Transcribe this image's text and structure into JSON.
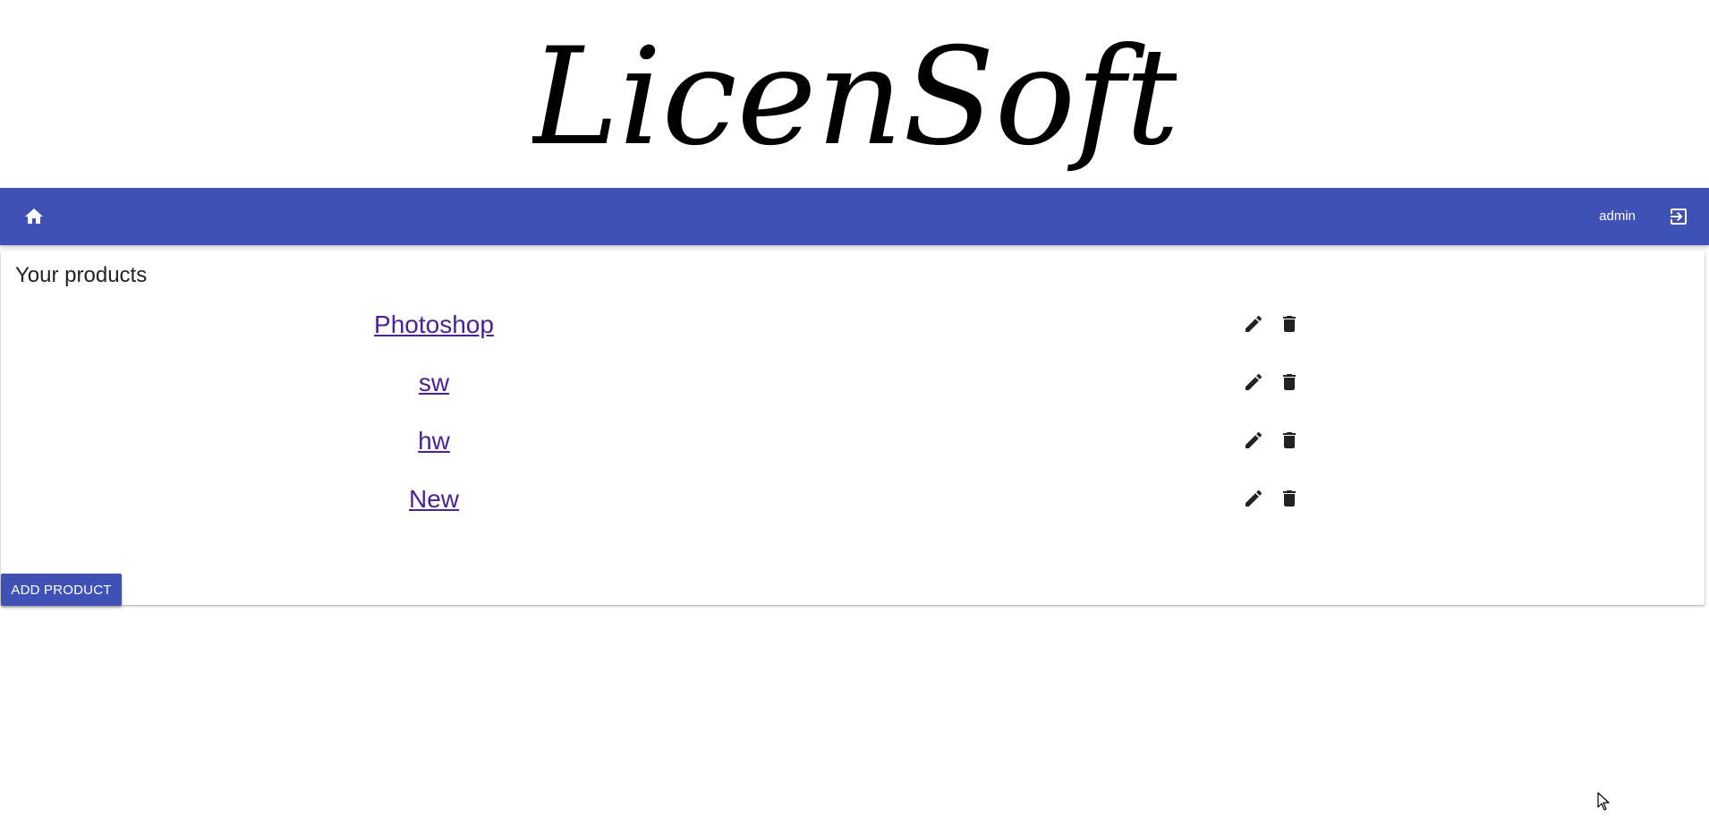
{
  "logo": {
    "text": "LicenSoft"
  },
  "appbar": {
    "home_icon": "home-icon",
    "username": "admin",
    "logout_icon": "logout-icon",
    "color": "#3f51b5"
  },
  "products_card": {
    "title": "Your products",
    "products": [
      {
        "name": "Photoshop"
      },
      {
        "name": "sw"
      },
      {
        "name": "hw"
      },
      {
        "name": "New"
      }
    ],
    "edit_icon": "pencil-icon",
    "delete_icon": "trash-icon",
    "add_button_label": "ADD PRODUCT"
  },
  "colors": {
    "accent": "#3f51b5",
    "link": "#4b2291",
    "icon": "#222222"
  }
}
